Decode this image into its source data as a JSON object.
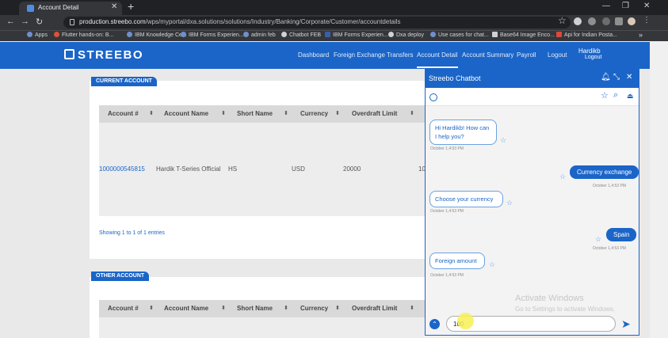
{
  "browser": {
    "tab_title": "Account Detail",
    "url_domain": "production.streebo.com",
    "url_path": "/wps/myportal/dxa.solutions/solutions/Industry/Banking/Corporate/Customer/accountdetails",
    "bookmarks": [
      "Apps",
      "Flutter hands-on: B...",
      "IBM Knowledge Ce...",
      "IBM Forms Experien...",
      "admin feb",
      "Chatbot FEB",
      "IBM Forms Experien...",
      "Dxa deploy",
      "Use cases for chat...",
      "Base64 Image Enco...",
      "Api for Indian Posta..."
    ]
  },
  "app": {
    "logo": "STREEBO",
    "nav": [
      "Dashboard",
      "Foreign Exchange",
      "Transfers",
      "Account Detail",
      "Account Summary",
      "Payroll",
      "Logout"
    ],
    "user_name": "Hardikb",
    "user_logout": "Logout"
  },
  "current_account": {
    "section_title": "CURRENT ACCOUNT",
    "columns": [
      "Account #",
      "Account Name",
      "Short Name",
      "Currency",
      "Overdraft Limit"
    ],
    "row": {
      "account": "1000000545815",
      "name": "Hardik T-Series Official",
      "short": "HS",
      "currency": "USD",
      "overdraft": "20000",
      "extra": "10"
    },
    "showing": "Showing 1 to 1 of 1 entries"
  },
  "other_account": {
    "section_title": "OTHER ACCOUNT",
    "columns": [
      "Account #",
      "Account Name",
      "Short Name",
      "Currency",
      "Overdraft Limit"
    ]
  },
  "chatbot": {
    "title": "Streebo Chatbot",
    "messages": {
      "m1": "Hi Hardikb! How can I help you?",
      "m1_time": "October 1,4:53 PM",
      "m2": "Currency exchange",
      "m2_time": "October 1,4:53 PM",
      "m3": "Choose your currency",
      "m3_time": "October 1,4:53 PM",
      "m4": "Spain",
      "m4_time": "October 1,4:53 PM",
      "m5": "Foreign amount",
      "m5_time": "October 1,4:53 PM"
    },
    "input_value": "100",
    "watermark_title": "Activate Windows",
    "watermark_sub": "Go to Settings to activate Windows."
  },
  "colors": {
    "brand": "#1b65c8"
  }
}
